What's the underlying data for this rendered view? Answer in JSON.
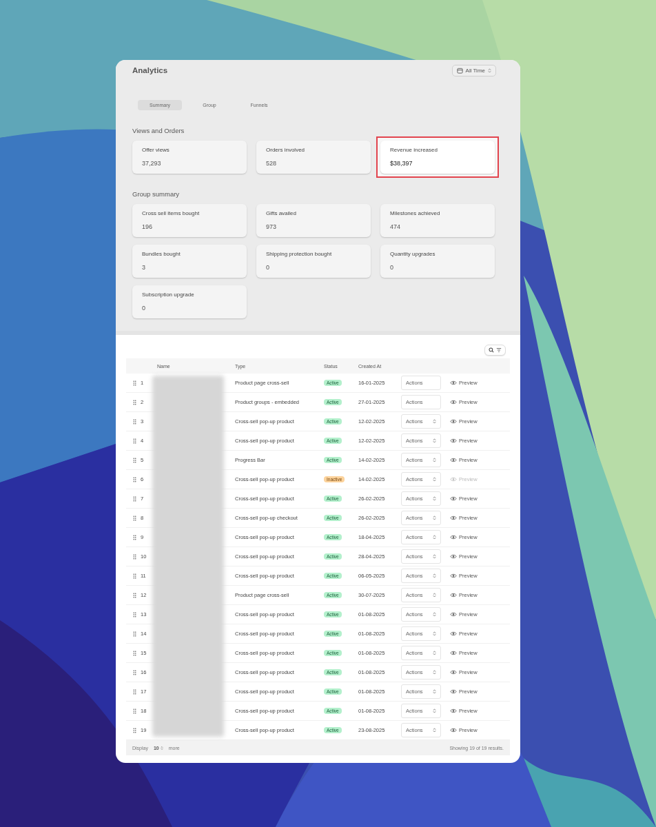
{
  "header": {
    "title": "Analytics",
    "date_range": "All Time"
  },
  "tabs": [
    {
      "label": "Summary",
      "selected": true
    },
    {
      "label": "Group",
      "selected": false
    },
    {
      "label": "Funnels",
      "selected": false
    }
  ],
  "sections": [
    {
      "title": "Views and Orders",
      "stats": [
        {
          "label": "Offer views",
          "value": "37,293",
          "highlighted": false
        },
        {
          "label": "Orders involved",
          "value": "528",
          "highlighted": false
        },
        {
          "label": "Revenue increased",
          "value": "$38,397",
          "highlighted": true
        }
      ]
    },
    {
      "title": "Group summary",
      "stats": [
        {
          "label": "Cross sell items bought",
          "value": "196",
          "highlighted": false
        },
        {
          "label": "Gifts availed",
          "value": "973",
          "highlighted": false
        },
        {
          "label": "Milestones achieved",
          "value": "474",
          "highlighted": false
        },
        {
          "label": "Bundles bought",
          "value": "3",
          "highlighted": false
        },
        {
          "label": "Shipping protection bought",
          "value": "0",
          "highlighted": false
        },
        {
          "label": "Quantity upgrades",
          "value": "0",
          "highlighted": false
        },
        {
          "label": "Subscription upgrade",
          "value": "0",
          "highlighted": false
        }
      ]
    }
  ],
  "table": {
    "columns": [
      "Name",
      "Type",
      "Status",
      "Created At"
    ],
    "rows": [
      {
        "number": "1",
        "type": "Product page cross-sell",
        "status": "Active",
        "kind": "active",
        "created": "16-01-2025",
        "actions": "Actions",
        "actions_menu": false,
        "preview": "Preview",
        "preview_disabled": false
      },
      {
        "number": "2",
        "type": "Product groups - embedded",
        "status": "Active",
        "kind": "active",
        "created": "27-01-2025",
        "actions": "Actions",
        "actions_menu": false,
        "preview": "Preview",
        "preview_disabled": false
      },
      {
        "number": "3",
        "type": "Cross-sell pop-up product",
        "status": "Active",
        "kind": "active",
        "created": "12-02-2025",
        "actions": "Actions",
        "actions_menu": true,
        "preview": "Preview",
        "preview_disabled": false
      },
      {
        "number": "4",
        "type": "Cross-sell pop-up product",
        "status": "Active",
        "kind": "active",
        "created": "12-02-2025",
        "actions": "Actions",
        "actions_menu": true,
        "preview": "Preview",
        "preview_disabled": false
      },
      {
        "number": "5",
        "type": "Progress Bar",
        "status": "Active",
        "kind": "active",
        "created": "14-02-2025",
        "actions": "Actions",
        "actions_menu": true,
        "preview": "Preview",
        "preview_disabled": false
      },
      {
        "number": "6",
        "type": "Cross-sell pop-up product",
        "status": "Inactive",
        "kind": "inactive",
        "created": "14-02-2025",
        "actions": "Actions",
        "actions_menu": true,
        "preview": "Preview",
        "preview_disabled": true
      },
      {
        "number": "7",
        "type": "Cross-sell pop-up product",
        "status": "Active",
        "kind": "active",
        "created": "26-02-2025",
        "actions": "Actions",
        "actions_menu": true,
        "preview": "Preview",
        "preview_disabled": false
      },
      {
        "number": "8",
        "type": "Cross-sell pop-up checkout",
        "status": "Active",
        "kind": "active",
        "created": "26-02-2025",
        "actions": "Actions",
        "actions_menu": true,
        "preview": "Preview",
        "preview_disabled": false
      },
      {
        "number": "9",
        "type": "Cross-sell pop-up product",
        "status": "Active",
        "kind": "active",
        "created": "18-04-2025",
        "actions": "Actions",
        "actions_menu": true,
        "preview": "Preview",
        "preview_disabled": false
      },
      {
        "number": "10",
        "type": "Cross-sell pop-up product",
        "status": "Active",
        "kind": "active",
        "created": "28-04-2025",
        "actions": "Actions",
        "actions_menu": true,
        "preview": "Preview",
        "preview_disabled": false
      },
      {
        "number": "11",
        "type": "Cross-sell pop-up product",
        "status": "Active",
        "kind": "active",
        "created": "06-05-2025",
        "actions": "Actions",
        "actions_menu": true,
        "preview": "Preview",
        "preview_disabled": false
      },
      {
        "number": "12",
        "type": "Product page cross-sell",
        "status": "Active",
        "kind": "active",
        "created": "30-07-2025",
        "actions": "Actions",
        "actions_menu": true,
        "preview": "Preview",
        "preview_disabled": false
      },
      {
        "number": "13",
        "type": "Cross-sell pop-up product",
        "status": "Active",
        "kind": "active",
        "created": "01-08-2025",
        "actions": "Actions",
        "actions_menu": true,
        "preview": "Preview",
        "preview_disabled": false
      },
      {
        "number": "14",
        "type": "Cross-sell pop-up product",
        "status": "Active",
        "kind": "active",
        "created": "01-08-2025",
        "actions": "Actions",
        "actions_menu": true,
        "preview": "Preview",
        "preview_disabled": false
      },
      {
        "number": "15",
        "type": "Cross-sell pop-up product",
        "status": "Active",
        "kind": "active",
        "created": "01-08-2025",
        "actions": "Actions",
        "actions_menu": true,
        "preview": "Preview",
        "preview_disabled": false
      },
      {
        "number": "16",
        "type": "Cross-sell pop-up product",
        "status": "Active",
        "kind": "active",
        "created": "01-08-2025",
        "actions": "Actions",
        "actions_menu": true,
        "preview": "Preview",
        "preview_disabled": false
      },
      {
        "number": "17",
        "type": "Cross-sell pop-up product",
        "status": "Active",
        "kind": "active",
        "created": "01-08-2025",
        "actions": "Actions",
        "actions_menu": true,
        "preview": "Preview",
        "preview_disabled": false
      },
      {
        "number": "18",
        "type": "Cross-sell pop-up product",
        "status": "Active",
        "kind": "active",
        "created": "01-08-2025",
        "actions": "Actions",
        "actions_menu": true,
        "preview": "Preview",
        "preview_disabled": false
      },
      {
        "number": "19",
        "type": "Cross-sell pop-up product",
        "status": "Active",
        "kind": "active",
        "created": "23-08-2025",
        "actions": "Actions",
        "actions_menu": true,
        "preview": "Preview",
        "preview_disabled": false
      }
    ],
    "footer": {
      "display_label": "Display",
      "page_size": "10",
      "more": "more",
      "summary": "Showing 19 of 19 results."
    }
  }
}
